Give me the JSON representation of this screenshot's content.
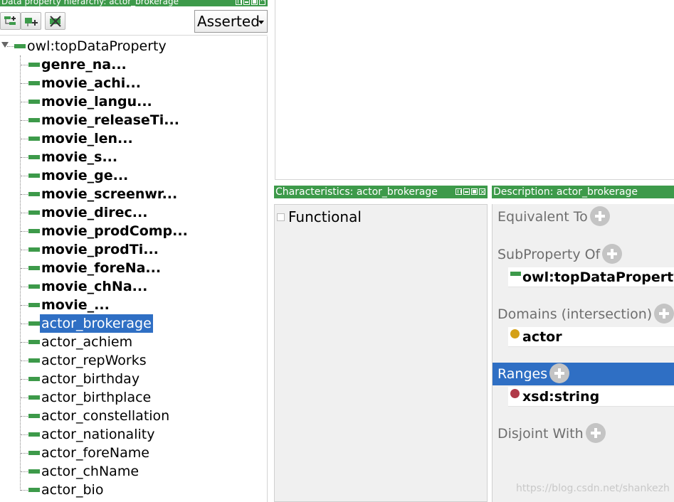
{
  "hierarchy_panel": {
    "title": "Data property hierarchy: actor_brokerage",
    "view_mode": "Asserted",
    "root": "owl:topDataProperty",
    "items": [
      {
        "label": "genre_na...",
        "bold": true
      },
      {
        "label": "movie_achi...",
        "bold": true
      },
      {
        "label": "movie_langu...",
        "bold": true
      },
      {
        "label": "movie_releaseTi...",
        "bold": true
      },
      {
        "label": "movie_len...",
        "bold": true
      },
      {
        "label": "movie_s...",
        "bold": true
      },
      {
        "label": "movie_ge...",
        "bold": true
      },
      {
        "label": "movie_screenwr...",
        "bold": true
      },
      {
        "label": "movie_direc...",
        "bold": true
      },
      {
        "label": "movie_prodComp...",
        "bold": true
      },
      {
        "label": "movie_prodTi...",
        "bold": true
      },
      {
        "label": "movie_foreNa...",
        "bold": true
      },
      {
        "label": "movie_chNa...",
        "bold": true
      },
      {
        "label": "movie_...",
        "bold": true
      },
      {
        "label": "actor_brokerage",
        "bold": false,
        "selected": true
      },
      {
        "label": "actor_achiem",
        "bold": false
      },
      {
        "label": "actor_repWorks",
        "bold": false
      },
      {
        "label": "actor_birthday",
        "bold": false
      },
      {
        "label": "actor_birthplace",
        "bold": false
      },
      {
        "label": "actor_constellation",
        "bold": false
      },
      {
        "label": "actor_nationality",
        "bold": false
      },
      {
        "label": "actor_foreName",
        "bold": false
      },
      {
        "label": "actor_chName",
        "bold": false
      },
      {
        "label": "actor_bio",
        "bold": false
      }
    ]
  },
  "characteristics_panel": {
    "title": "Characteristics: actor_brokerage",
    "functional_label": "Functional"
  },
  "description_panel": {
    "title": "Description: actor_brokerage",
    "equivalent_to": "Equivalent To",
    "subproperty_of": "SubProperty Of",
    "subproperty_value": "owl:topDataProperty",
    "domains": "Domains (intersection)",
    "domain_value": "actor",
    "ranges": "Ranges",
    "range_value": "xsd:string",
    "disjoint_with": "Disjoint With"
  },
  "watermark": "https://blog.csdn.net/shankezh",
  "colors": {
    "accent_green": "#3d9a4a",
    "selection_blue": "#2f6fc4",
    "domain_dot": "#d4a017",
    "range_dot": "#b03a48"
  }
}
